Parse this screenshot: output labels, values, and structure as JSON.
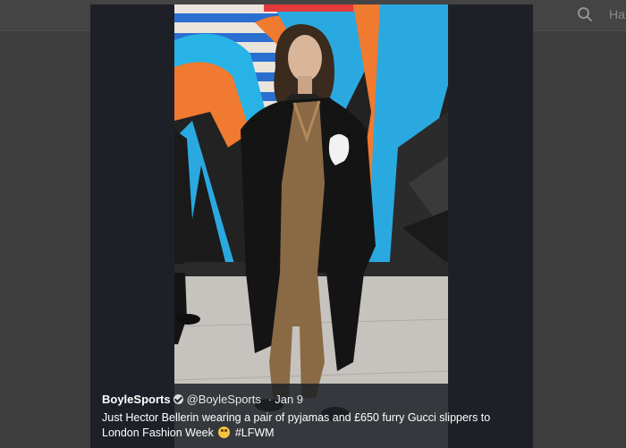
{
  "header": {
    "search_icon": "search-icon",
    "partial_text": "Ha"
  },
  "tweet": {
    "author_name": "BoyleSports",
    "verified_icon": "verified-badge-icon",
    "handle": "@BoyleSports",
    "separator": "·",
    "date": "Jan 9",
    "text": "Just Hector Bellerin wearing a pair of pyjamas and £650 furry Gucci slippers to London Fashion Week",
    "emoji_icon": "flushed-face-emoji-icon",
    "hashtag": "#LFWM"
  },
  "colors": {
    "page_bg": "#3d3d3d",
    "modal_bg": "#1d2127",
    "text": "#ffffff"
  }
}
